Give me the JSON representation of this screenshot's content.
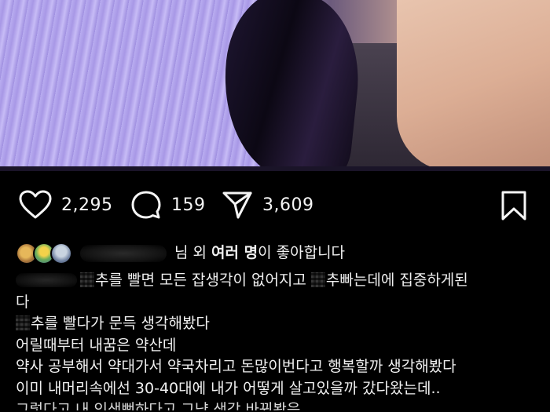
{
  "post": {
    "actions": {
      "likes": "2,295",
      "comments": "159",
      "shares": "3,609"
    },
    "liked_by": {
      "suffix": "님 외",
      "bold": "여러 명",
      "tail": "이 좋아합니다"
    },
    "caption_lines": {
      "l1_a": "추를 빨면 모든 잡생각이 없어지고 ",
      "l1_b": "추빠는데에 집중하게된",
      "l2": "다",
      "l3": "추를 빨다가 문득 생각해봤다",
      "l4": "어릴때부터 내꿈은 약산데",
      "l5": "약사 공부해서 약대가서 약국차리고 돈많이번다고 행복할까 생각해봤다",
      "l6": "이미 내머리속에선  30-40대에 내가 어떻게 살고있을까 갔다왔는데..",
      "l7": "그렇다고 내 인생뻔하다고 그냥 생각 바꿔봤음"
    }
  },
  "icons": {
    "like": "heart-icon",
    "comment": "comment-bubble-icon",
    "share": "paper-plane-icon",
    "save": "bookmark-icon"
  }
}
